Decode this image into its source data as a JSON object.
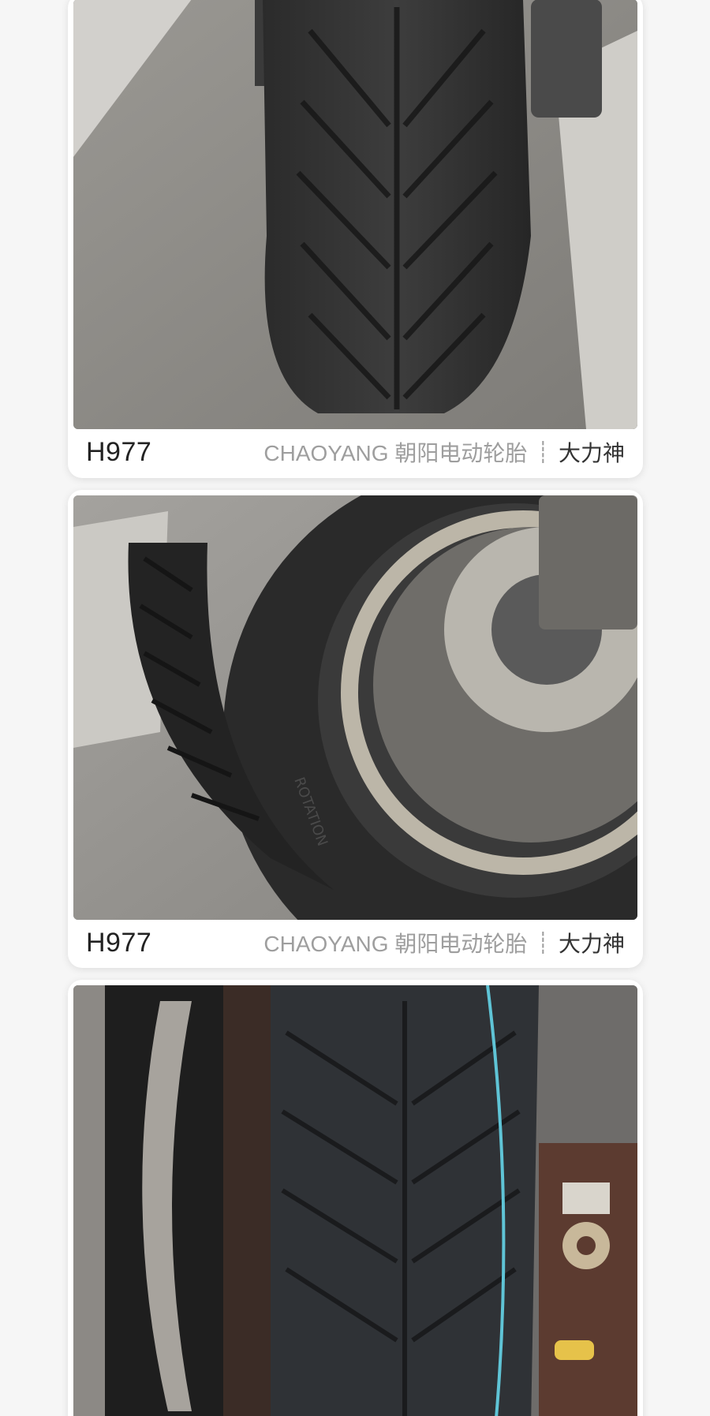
{
  "cards": [
    {
      "photo": {
        "subject": "tire-tread-front-view"
      },
      "model": "H977",
      "brand": "CHAOYANG 朝阳电动轮胎",
      "divider": "┊",
      "series": "大力神"
    },
    {
      "photo": {
        "subject": "tire-sidewall-with-brake-disc"
      },
      "model": "H977",
      "brand": "CHAOYANG 朝阳电动轮胎",
      "divider": "┊",
      "series": "大力神"
    },
    {
      "photo": {
        "subject": "new-tire-tread-closeup"
      }
    }
  ],
  "colors": {
    "background": "#f6f6f6",
    "card": "#ffffff",
    "brand_text": "#9e9e9e",
    "model_text": "#222222",
    "series_text": "#333333"
  }
}
